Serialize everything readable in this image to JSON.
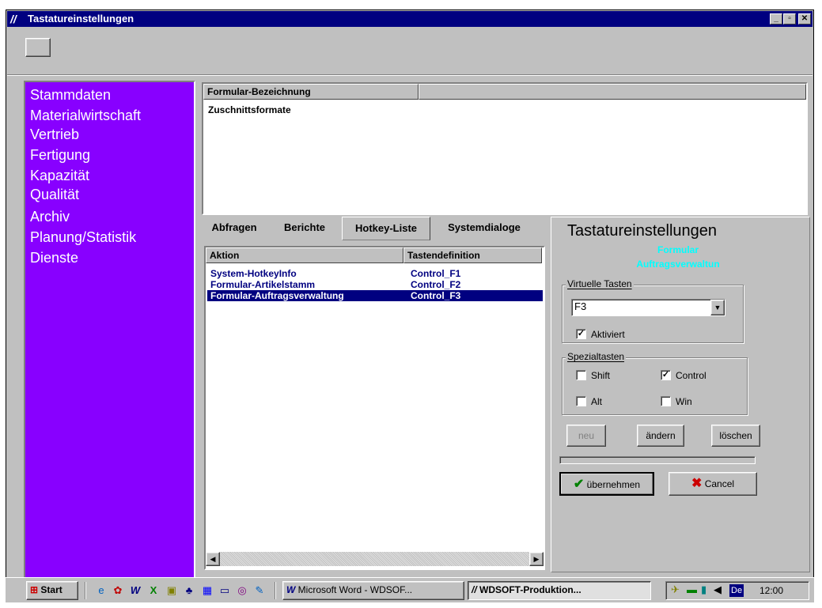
{
  "window": {
    "title": "Tastatureinstellungen",
    "controls": {
      "minimize": "_",
      "maximize": "▫",
      "close": "✕"
    }
  },
  "sidebar": {
    "items": [
      "Stammdaten",
      "Materialwirtschaft",
      "Vertrieb",
      "Fertigung",
      "Kapazität",
      "Qualität",
      "Archiv",
      "Planung/Statistik",
      "Dienste"
    ]
  },
  "form_panel": {
    "header": "Formular-Bezeichnung",
    "value": "Zuschnittsformate"
  },
  "tabs": [
    "Abfragen",
    "Berichte",
    "Hotkey-Liste",
    "Systemdialoge"
  ],
  "active_tab": "Hotkey-Liste",
  "hotkey_list": {
    "columns": [
      "Aktion",
      "Tastendefinition"
    ],
    "rows": [
      {
        "action": "System-HotkeyInfo",
        "key": "Control_F1"
      },
      {
        "action": "Formular-Artikelstamm",
        "key": "Control_F2"
      },
      {
        "action": "Formular-Auftragsverwaltung",
        "key": "Control_F3"
      }
    ],
    "selected_index": 2
  },
  "settings": {
    "title": "Tastatureinstellungen",
    "subtitle_1": "Formular",
    "subtitle_2": "Auftragsverwaltun",
    "virtual_group_label": "Virtuelle Tasten",
    "virtual_key_value": "F3",
    "activated_label": "Aktiviert",
    "activated_checked": true,
    "special_group_label": "Spezialtasten",
    "shift_label": "Shift",
    "shift_checked": false,
    "control_label": "Control",
    "control_checked": true,
    "alt_label": "Alt",
    "alt_checked": false,
    "win_label": "Win",
    "win_checked": false,
    "new_label": "neu",
    "change_label": "ändern",
    "delete_label": "löschen",
    "apply_label": "übernehmen",
    "cancel_label": "Cancel",
    "accent_cyan": "#00ffff"
  },
  "taskbar": {
    "start_label": "Start",
    "tasks": [
      "Microsoft Word - WDSOF...",
      "WDSOFT-Produktion..."
    ],
    "tray_language": "De",
    "clock": "12:00"
  },
  "colors": {
    "sidebar_bg": "#8800ff",
    "titlebar_bg": "#000080",
    "selection_bg": "#000080",
    "list_text": "#000080"
  }
}
